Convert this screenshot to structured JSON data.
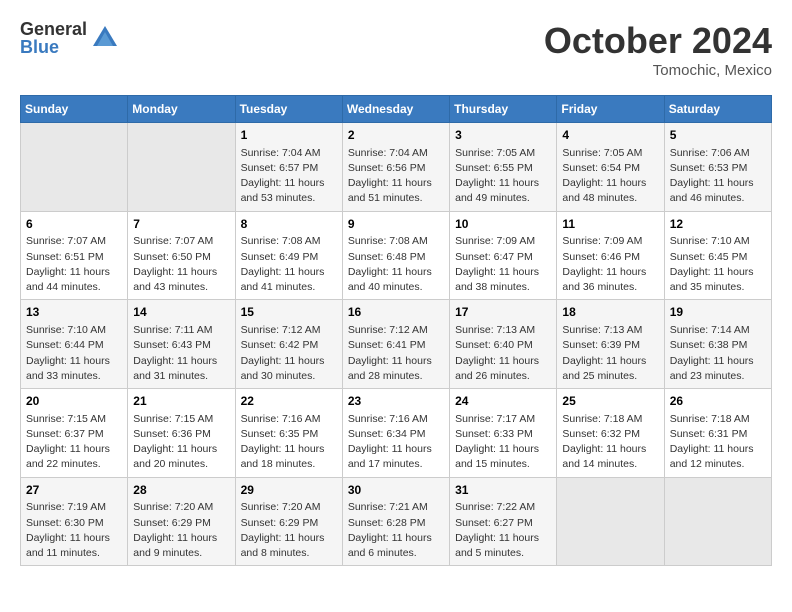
{
  "logo": {
    "general": "General",
    "blue": "Blue"
  },
  "header": {
    "month": "October 2024",
    "location": "Tomochic, Mexico"
  },
  "days_of_week": [
    "Sunday",
    "Monday",
    "Tuesday",
    "Wednesday",
    "Thursday",
    "Friday",
    "Saturday"
  ],
  "weeks": [
    [
      {
        "day": "",
        "empty": true
      },
      {
        "day": "",
        "empty": true
      },
      {
        "day": "1",
        "sunrise": "7:04 AM",
        "sunset": "6:57 PM",
        "daylight": "11 hours and 53 minutes."
      },
      {
        "day": "2",
        "sunrise": "7:04 AM",
        "sunset": "6:56 PM",
        "daylight": "11 hours and 51 minutes."
      },
      {
        "day": "3",
        "sunrise": "7:05 AM",
        "sunset": "6:55 PM",
        "daylight": "11 hours and 49 minutes."
      },
      {
        "day": "4",
        "sunrise": "7:05 AM",
        "sunset": "6:54 PM",
        "daylight": "11 hours and 48 minutes."
      },
      {
        "day": "5",
        "sunrise": "7:06 AM",
        "sunset": "6:53 PM",
        "daylight": "11 hours and 46 minutes."
      }
    ],
    [
      {
        "day": "6",
        "sunrise": "7:07 AM",
        "sunset": "6:51 PM",
        "daylight": "11 hours and 44 minutes."
      },
      {
        "day": "7",
        "sunrise": "7:07 AM",
        "sunset": "6:50 PM",
        "daylight": "11 hours and 43 minutes."
      },
      {
        "day": "8",
        "sunrise": "7:08 AM",
        "sunset": "6:49 PM",
        "daylight": "11 hours and 41 minutes."
      },
      {
        "day": "9",
        "sunrise": "7:08 AM",
        "sunset": "6:48 PM",
        "daylight": "11 hours and 40 minutes."
      },
      {
        "day": "10",
        "sunrise": "7:09 AM",
        "sunset": "6:47 PM",
        "daylight": "11 hours and 38 minutes."
      },
      {
        "day": "11",
        "sunrise": "7:09 AM",
        "sunset": "6:46 PM",
        "daylight": "11 hours and 36 minutes."
      },
      {
        "day": "12",
        "sunrise": "7:10 AM",
        "sunset": "6:45 PM",
        "daylight": "11 hours and 35 minutes."
      }
    ],
    [
      {
        "day": "13",
        "sunrise": "7:10 AM",
        "sunset": "6:44 PM",
        "daylight": "11 hours and 33 minutes."
      },
      {
        "day": "14",
        "sunrise": "7:11 AM",
        "sunset": "6:43 PM",
        "daylight": "11 hours and 31 minutes."
      },
      {
        "day": "15",
        "sunrise": "7:12 AM",
        "sunset": "6:42 PM",
        "daylight": "11 hours and 30 minutes."
      },
      {
        "day": "16",
        "sunrise": "7:12 AM",
        "sunset": "6:41 PM",
        "daylight": "11 hours and 28 minutes."
      },
      {
        "day": "17",
        "sunrise": "7:13 AM",
        "sunset": "6:40 PM",
        "daylight": "11 hours and 26 minutes."
      },
      {
        "day": "18",
        "sunrise": "7:13 AM",
        "sunset": "6:39 PM",
        "daylight": "11 hours and 25 minutes."
      },
      {
        "day": "19",
        "sunrise": "7:14 AM",
        "sunset": "6:38 PM",
        "daylight": "11 hours and 23 minutes."
      }
    ],
    [
      {
        "day": "20",
        "sunrise": "7:15 AM",
        "sunset": "6:37 PM",
        "daylight": "11 hours and 22 minutes."
      },
      {
        "day": "21",
        "sunrise": "7:15 AM",
        "sunset": "6:36 PM",
        "daylight": "11 hours and 20 minutes."
      },
      {
        "day": "22",
        "sunrise": "7:16 AM",
        "sunset": "6:35 PM",
        "daylight": "11 hours and 18 minutes."
      },
      {
        "day": "23",
        "sunrise": "7:16 AM",
        "sunset": "6:34 PM",
        "daylight": "11 hours and 17 minutes."
      },
      {
        "day": "24",
        "sunrise": "7:17 AM",
        "sunset": "6:33 PM",
        "daylight": "11 hours and 15 minutes."
      },
      {
        "day": "25",
        "sunrise": "7:18 AM",
        "sunset": "6:32 PM",
        "daylight": "11 hours and 14 minutes."
      },
      {
        "day": "26",
        "sunrise": "7:18 AM",
        "sunset": "6:31 PM",
        "daylight": "11 hours and 12 minutes."
      }
    ],
    [
      {
        "day": "27",
        "sunrise": "7:19 AM",
        "sunset": "6:30 PM",
        "daylight": "11 hours and 11 minutes."
      },
      {
        "day": "28",
        "sunrise": "7:20 AM",
        "sunset": "6:29 PM",
        "daylight": "11 hours and 9 minutes."
      },
      {
        "day": "29",
        "sunrise": "7:20 AM",
        "sunset": "6:29 PM",
        "daylight": "11 hours and 8 minutes."
      },
      {
        "day": "30",
        "sunrise": "7:21 AM",
        "sunset": "6:28 PM",
        "daylight": "11 hours and 6 minutes."
      },
      {
        "day": "31",
        "sunrise": "7:22 AM",
        "sunset": "6:27 PM",
        "daylight": "11 hours and 5 minutes."
      },
      {
        "day": "",
        "empty": true
      },
      {
        "day": "",
        "empty": true
      }
    ]
  ],
  "labels": {
    "sunrise": "Sunrise:",
    "sunset": "Sunset:",
    "daylight": "Daylight:"
  }
}
